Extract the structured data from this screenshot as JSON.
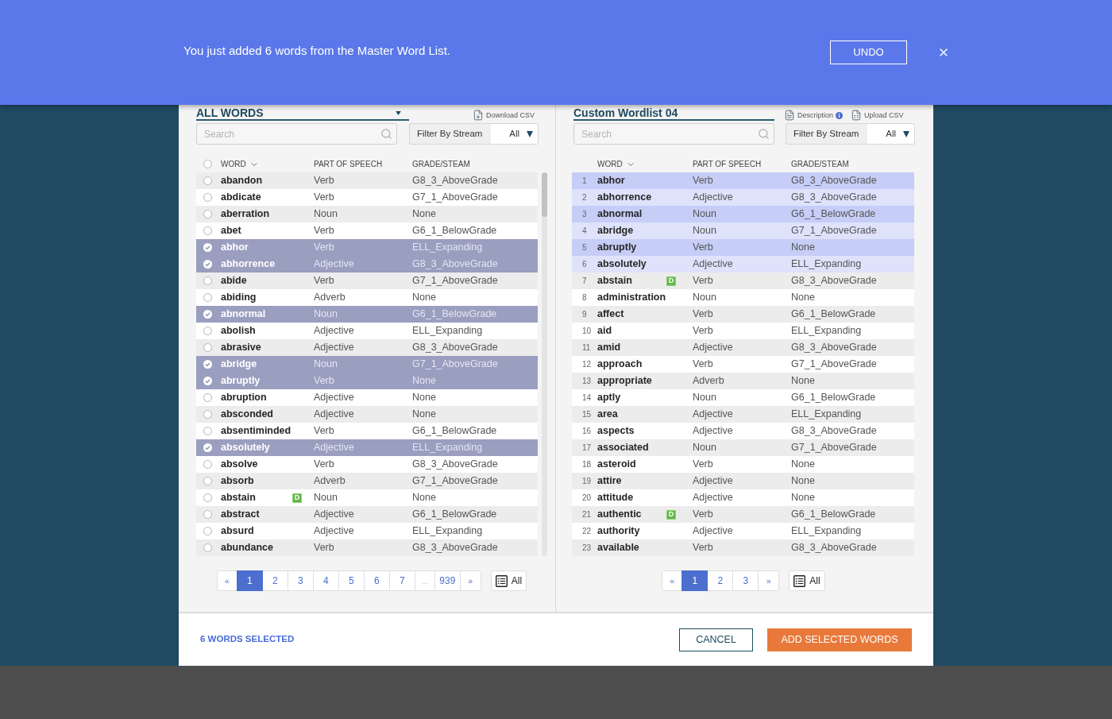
{
  "banner": {
    "message": "You just added 6 words from the Master Word List.",
    "undo_label": "UNDO"
  },
  "left_panel": {
    "title": {
      "kind": "select",
      "value": "ALL WORDS"
    },
    "actions": [
      {
        "kind": "download",
        "label": "Download CSV"
      }
    ],
    "search": {
      "placeholder": "Search"
    },
    "filter": {
      "label": "Filter By Stream",
      "value": "All"
    },
    "select_all": false,
    "columns": [
      {
        "label": "WORD",
        "sorted": true
      },
      {
        "label": "PART OF SPEECH",
        "sorted": false
      },
      {
        "label": "GRADE/STEAM",
        "sorted": false
      }
    ],
    "rows": [
      {
        "word": "abandon",
        "part_of_speech": "Verb",
        "grade": "G8_3_AboveGrade",
        "selected": false
      },
      {
        "word": "abdicate",
        "part_of_speech": "Verb",
        "grade": "G7_1_AboveGrade",
        "selected": false
      },
      {
        "word": "aberration",
        "part_of_speech": "Noun",
        "grade": "None",
        "selected": false
      },
      {
        "word": "abet",
        "part_of_speech": "Verb",
        "grade": "G6_1_BelowGrade",
        "selected": false
      },
      {
        "word": "abhor",
        "part_of_speech": "Verb",
        "grade": "ELL_Expanding",
        "selected": true
      },
      {
        "word": "abhorrence",
        "part_of_speech": "Adjective",
        "grade": "G8_3_AboveGrade",
        "selected": true
      },
      {
        "word": "abide",
        "part_of_speech": "Verb",
        "grade": "G7_1_AboveGrade",
        "selected": false
      },
      {
        "word": "abiding",
        "part_of_speech": "Adverb",
        "grade": "None",
        "selected": false
      },
      {
        "word": "abnormal",
        "part_of_speech": "Noun",
        "grade": "G6_1_BelowGrade",
        "selected": true
      },
      {
        "word": "abolish",
        "part_of_speech": "Adjective",
        "grade": "ELL_Expanding",
        "selected": false
      },
      {
        "word": "abrasive",
        "part_of_speech": "Adjective",
        "grade": "G8_3_AboveGrade",
        "selected": false
      },
      {
        "word": "abridge",
        "part_of_speech": "Noun",
        "grade": "G7_1_AboveGrade",
        "selected": true
      },
      {
        "word": "abruptly",
        "part_of_speech": "Verb",
        "grade": "None",
        "selected": true
      },
      {
        "word": "abruption",
        "part_of_speech": "Adjective",
        "grade": "None",
        "selected": false
      },
      {
        "word": "absconded",
        "part_of_speech": "Adjective",
        "grade": "None",
        "selected": false
      },
      {
        "word": "absentiminded",
        "part_of_speech": "Verb",
        "grade": "G6_1_BelowGrade",
        "selected": false
      },
      {
        "word": "absolutely",
        "part_of_speech": "Adjective",
        "grade": "ELL_Expanding",
        "selected": true
      },
      {
        "word": "absolve",
        "part_of_speech": "Verb",
        "grade": "G8_3_AboveGrade",
        "selected": false
      },
      {
        "word": "absorb",
        "part_of_speech": "Adverb",
        "grade": "G7_1_AboveGrade",
        "selected": false
      },
      {
        "word": "abstain",
        "badge": "D",
        "part_of_speech": "Noun",
        "grade": "None",
        "selected": false
      },
      {
        "word": "abstract",
        "part_of_speech": "Adjective",
        "grade": "G6_1_BelowGrade",
        "selected": false
      },
      {
        "word": "absurd",
        "part_of_speech": "Adjective",
        "grade": "ELL_Expanding",
        "selected": false
      },
      {
        "word": "abundance",
        "part_of_speech": "Verb",
        "grade": "G8_3_AboveGrade",
        "selected": false
      }
    ],
    "pagination": {
      "items": [
        {
          "kind": "prev",
          "label": "«",
          "selected": false
        },
        {
          "kind": "page",
          "label": "1",
          "selected": true
        },
        {
          "kind": "page",
          "label": "2",
          "selected": false
        },
        {
          "kind": "page",
          "label": "3",
          "selected": false
        },
        {
          "kind": "page",
          "label": "4",
          "selected": false
        },
        {
          "kind": "page",
          "label": "5",
          "selected": false
        },
        {
          "kind": "page",
          "label": "6",
          "selected": false
        },
        {
          "kind": "page",
          "label": "7",
          "selected": false
        },
        {
          "kind": "ellipsis",
          "label": "...",
          "selected": false
        },
        {
          "kind": "page",
          "label": "939",
          "selected": false
        },
        {
          "kind": "next",
          "label": "»",
          "selected": false
        }
      ],
      "all_label": "All"
    }
  },
  "right_panel": {
    "title": {
      "kind": "field",
      "value": "Custom Wordlist 04"
    },
    "actions": [
      {
        "kind": "description",
        "label": "Description"
      },
      {
        "kind": "upload",
        "label": "Upload CSV"
      }
    ],
    "search": {
      "placeholder": "Search"
    },
    "filter": {
      "label": "Filter By Stream",
      "value": "All"
    },
    "columns": [
      {
        "label": "WORD",
        "sorted": true
      },
      {
        "label": "PART OF SPEECH",
        "sorted": false
      },
      {
        "label": "GRADE/STEAM",
        "sorted": false
      }
    ],
    "rows": [
      {
        "number": "1",
        "word": "abhor",
        "part_of_speech": "Verb",
        "grade": "G8_3_AboveGrade",
        "highlighted": true
      },
      {
        "number": "2",
        "word": "abhorrence",
        "part_of_speech": "Adjective",
        "grade": "G8_3_AboveGrade",
        "highlighted": true
      },
      {
        "number": "3",
        "word": "abnormal",
        "part_of_speech": "Noun",
        "grade": "G6_1_BelowGrade",
        "highlighted": true
      },
      {
        "number": "4",
        "word": "abridge",
        "part_of_speech": "Noun",
        "grade": "G7_1_AboveGrade",
        "highlighted": true
      },
      {
        "number": "5",
        "word": "abruptly",
        "part_of_speech": "Verb",
        "grade": "None",
        "highlighted": true
      },
      {
        "number": "6",
        "word": "absolutely",
        "part_of_speech": "Adjective",
        "grade": "ELL_Expanding",
        "highlighted": true
      },
      {
        "number": "7",
        "word": "abstain",
        "badge": "D",
        "part_of_speech": "Verb",
        "grade": "G8_3_AboveGrade",
        "highlighted": false
      },
      {
        "number": "8",
        "word": "administration",
        "part_of_speech": "Noun",
        "grade": "None",
        "highlighted": false
      },
      {
        "number": "9",
        "word": "affect",
        "part_of_speech": "Verb",
        "grade": "G6_1_BelowGrade",
        "highlighted": false
      },
      {
        "number": "10",
        "word": "aid",
        "part_of_speech": "Verb",
        "grade": "ELL_Expanding",
        "highlighted": false
      },
      {
        "number": "11",
        "word": "amid",
        "part_of_speech": "Adjective",
        "grade": "G8_3_AboveGrade",
        "highlighted": false
      },
      {
        "number": "12",
        "word": "approach",
        "part_of_speech": "Verb",
        "grade": "G7_1_AboveGrade",
        "highlighted": false
      },
      {
        "number": "13",
        "word": "appropriate",
        "part_of_speech": "Adverb",
        "grade": "None",
        "highlighted": false
      },
      {
        "number": "14",
        "word": "aptly",
        "part_of_speech": "Noun",
        "grade": "G6_1_BelowGrade",
        "highlighted": false
      },
      {
        "number": "15",
        "word": "area",
        "part_of_speech": "Adjective",
        "grade": "ELL_Expanding",
        "highlighted": false
      },
      {
        "number": "16",
        "word": "aspects",
        "part_of_speech": "Adjective",
        "grade": "G8_3_AboveGrade",
        "highlighted": false
      },
      {
        "number": "17",
        "word": "associated",
        "part_of_speech": "Noun",
        "grade": "G7_1_AboveGrade",
        "highlighted": false
      },
      {
        "number": "18",
        "word": "asteroid",
        "part_of_speech": "Verb",
        "grade": "None",
        "highlighted": false
      },
      {
        "number": "19",
        "word": "attire",
        "part_of_speech": "Adjective",
        "grade": "None",
        "highlighted": false
      },
      {
        "number": "20",
        "word": "attitude",
        "part_of_speech": "Adjective",
        "grade": "None",
        "highlighted": false
      },
      {
        "number": "21",
        "word": "authentic",
        "badge": "D",
        "part_of_speech": "Verb",
        "grade": "G6_1_BelowGrade",
        "highlighted": false
      },
      {
        "number": "22",
        "word": "authority",
        "part_of_speech": "Adjective",
        "grade": "ELL_Expanding",
        "highlighted": false
      },
      {
        "number": "23",
        "word": "available",
        "part_of_speech": "Verb",
        "grade": "G8_3_AboveGrade",
        "highlighted": false
      }
    ],
    "pagination": {
      "items": [
        {
          "kind": "prev",
          "label": "«",
          "selected": false
        },
        {
          "kind": "page",
          "label": "1",
          "selected": true
        },
        {
          "kind": "page",
          "label": "2",
          "selected": false
        },
        {
          "kind": "page",
          "label": "3",
          "selected": false
        },
        {
          "kind": "next",
          "label": "»",
          "selected": false
        }
      ],
      "all_label": "All"
    }
  },
  "footer": {
    "selection_count": "6 WORDS SELECTED",
    "buttons": [
      {
        "kind": "secondary",
        "label": "CANCEL"
      },
      {
        "kind": "primary",
        "label": "ADD SELECTED WORDS"
      }
    ]
  }
}
